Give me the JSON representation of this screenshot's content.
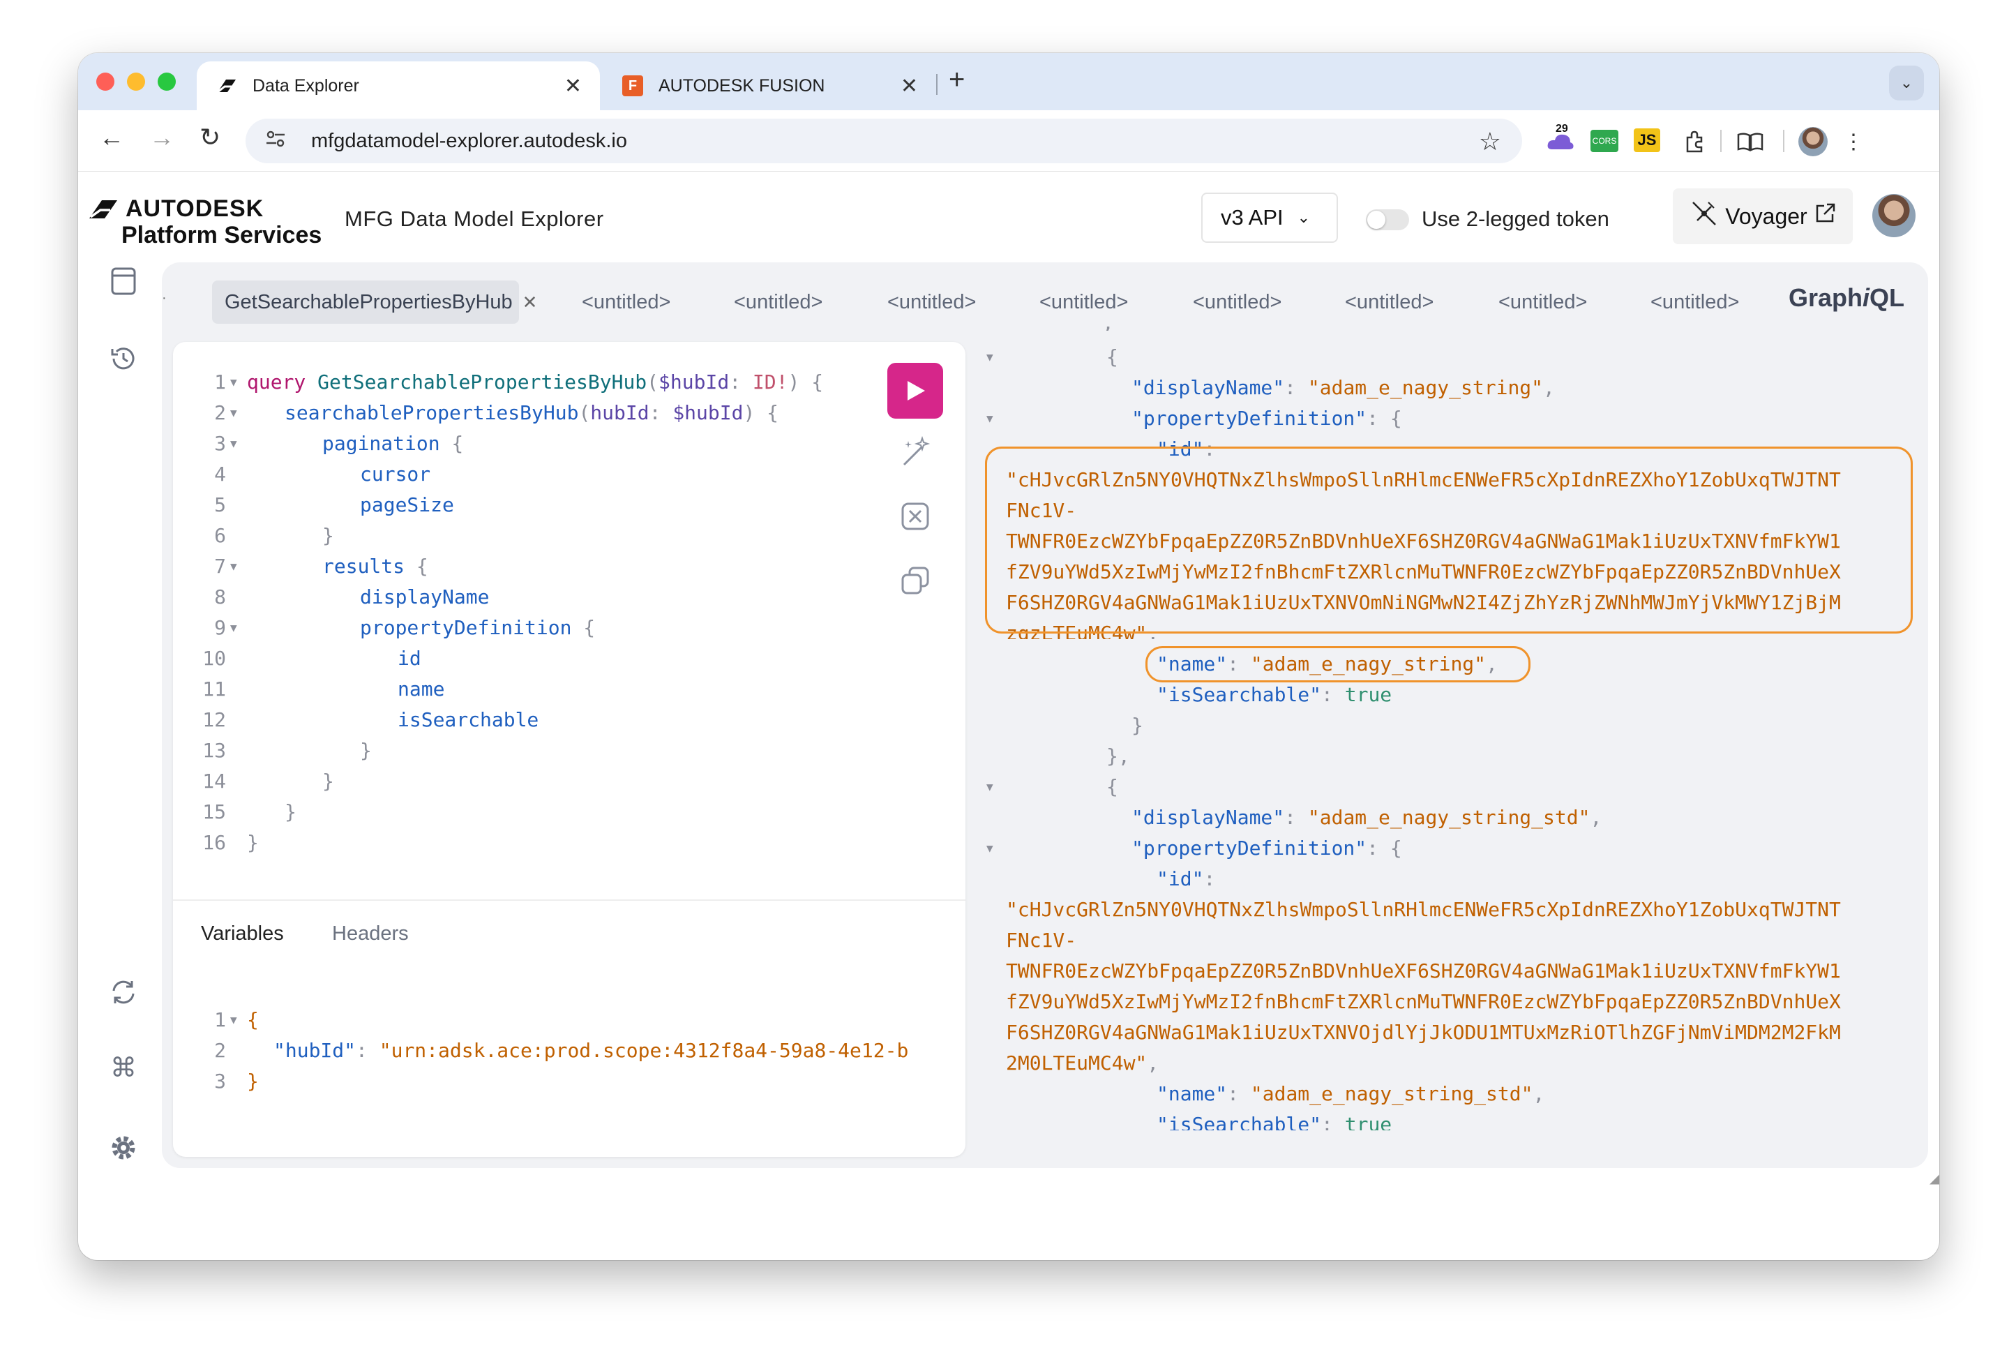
{
  "browser": {
    "tabs": [
      {
        "title": "Data Explorer",
        "active": true
      },
      {
        "title": "AUTODESK FUSION",
        "active": false
      }
    ],
    "url": "mfgdatamodel-explorer.autodesk.io",
    "extension_badge": "29"
  },
  "app": {
    "logo_line1": "AUTODESK",
    "logo_line2": "Platform Services",
    "title": "MFG Data Model Explorer",
    "api_version": "v3 API",
    "toggle_label": "Use 2-legged token",
    "voyager_label": "Voyager"
  },
  "graphiql": {
    "brand_prefix": "Graph",
    "brand_italic": "i",
    "brand_suffix": "QL",
    "tabs": [
      "GetSearchablePropertiesByHub",
      "<untitled>",
      "<untitled>",
      "<untitled>",
      "<untitled>",
      "<untitled>",
      "<untitled>",
      "<untitled>",
      "<untitled>"
    ],
    "query": {
      "l1_kw": "query",
      "l1_op": "GetSearchablePropertiesByHub",
      "l1_var": "$hubId",
      "l1_type": "ID!",
      "l2_field": "searchablePropertiesByHub",
      "l2_arg": "hubId",
      "l2_var": "$hubId",
      "pagination": "pagination",
      "cursor": "cursor",
      "pageSize": "pageSize",
      "results": "results",
      "displayName": "displayName",
      "propertyDefinition": "propertyDefinition",
      "id": "id",
      "name": "name",
      "isSearchable": "isSearchable"
    },
    "variables_tab": "Variables",
    "headers_tab": "Headers",
    "variables": {
      "key": "\"hubId\"",
      "value": "\"urn:adsk.ace:prod.scope:4312f8a4-59a8-4e12-b"
    },
    "result": {
      "k_displayName": "\"displayName\"",
      "k_propertyDefinition": "\"propertyDefinition\"",
      "k_id": "\"id\"",
      "k_name": "\"name\"",
      "k_isSearchable": "\"isSearchable\"",
      "true": "true",
      "item1": {
        "displayName": "\"adam_e_nagy_string\"",
        "id_lines": [
          "\"cHJvcGRlZn5NY0VHQTNxZlhsWmpoSllnRHlmcENWeFR5cXpIdnREZXhoY1ZobUxqTWJTNT",
          "FNc1V-",
          "TWNFR0EzcWZYbFpqaEpZZ0R5ZnBDVnhUeXF6SHZ0RGV4aGNWaG1Mak1iUzUxTXNVfmFkYW1",
          "fZV9uYWd5XzIwMjYwMzI2fnBhcmFtZXRlcnMuTWNFR0EzcWZYbFpqaEpZZ0R5ZnBDVnhUeX",
          "F6SHZ0RGV4aGNWaG1Mak1iUzUxTXNVOmNiNGMwN2I4ZjZhYzRjZWNhMWJmYjVkMWY1ZjBjM",
          "zgzLTEuMC4w\""
        ],
        "name": "\"adam_e_nagy_string\""
      },
      "item2": {
        "displayName": "\"adam_e_nagy_string_std\"",
        "id_lines": [
          "\"cHJvcGRlZn5NY0VHQTNxZlhsWmpoSllnRHlmcENWeFR5cXpIdnREZXhoY1ZobUxqTWJTNT",
          "FNc1V-",
          "TWNFR0EzcWZYbFpqaEpZZ0R5ZnBDVnhUeXF6SHZ0RGV4aGNWaG1Mak1iUzUxTXNVfmFkYW1",
          "fZV9uYWd5XzIwMjYwMzI2fnBhcmFtZXRlcnMuTWNFR0EzcWZYbFpqaEpZZ0R5ZnBDVnhUeX",
          "F6SHZ0RGV4aGNWaG1Mak1iUzUxTXNVOjdlYjJkODU1MTUxMzRiOTlhZGFjNmViMDM2M2FkM",
          "2M0LTEuMC4w\""
        ],
        "name": "\"adam_e_nagy_string_std\""
      }
    }
  },
  "colors": {
    "run_button": "#d6268a",
    "highlight_box": "#f0932b",
    "string": "#c06000",
    "keyword": "#b0166d"
  }
}
